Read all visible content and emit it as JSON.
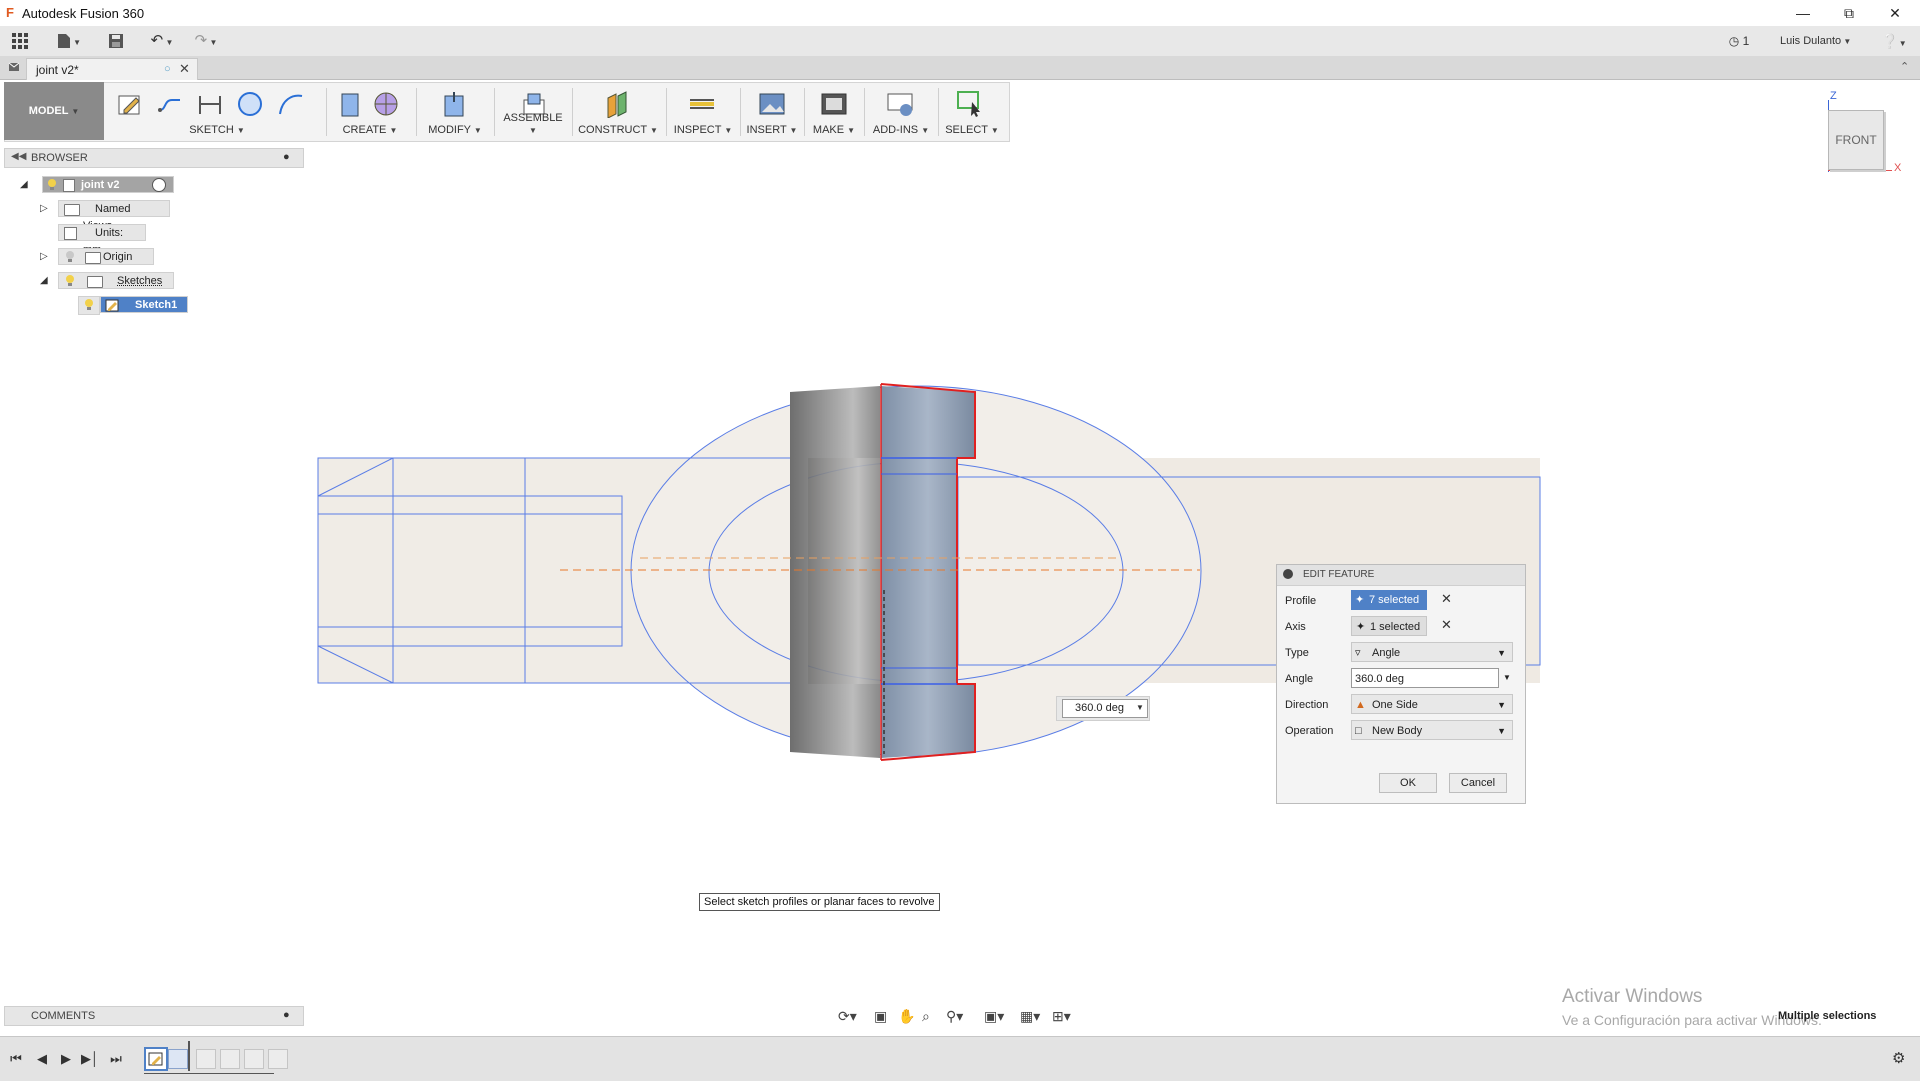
{
  "window": {
    "title": "Autodesk Fusion 360"
  },
  "qat": {
    "job_count": "1",
    "user": "Luis Dulanto"
  },
  "doc_tab": {
    "label": "joint v2*"
  },
  "toolbar": {
    "workspace": "MODEL",
    "groups": [
      "SKETCH",
      "CREATE",
      "MODIFY",
      "ASSEMBLE",
      "CONSTRUCT",
      "INSPECT",
      "INSERT",
      "MAKE",
      "ADD-INS",
      "SELECT"
    ]
  },
  "browser": {
    "title": "BROWSER",
    "root": "joint v2",
    "items": [
      "Named Views",
      "Units: mm",
      "Origin",
      "Sketches"
    ],
    "sketch": "Sketch1"
  },
  "viewcube": {
    "face": "FRONT",
    "axis_z": "Z",
    "axis_x": "X"
  },
  "edit_feature": {
    "title": "EDIT FEATURE",
    "rows": {
      "profile": {
        "label": "Profile",
        "value": "7 selected"
      },
      "axis": {
        "label": "Axis",
        "value": "1 selected"
      },
      "type": {
        "label": "Type",
        "value": "Angle"
      },
      "angle": {
        "label": "Angle",
        "value": "360.0 deg"
      },
      "direction": {
        "label": "Direction",
        "value": "One Side"
      },
      "operation": {
        "label": "Operation",
        "value": "New Body"
      }
    },
    "ok": "OK",
    "cancel": "Cancel"
  },
  "viewport": {
    "angle_input": "360.0 deg",
    "hint": "Select sketch profiles or planar faces to revolve"
  },
  "comments": {
    "title": "COMMENTS"
  },
  "status": {
    "watermark_title": "Activar Windows",
    "watermark_sub": "Ve a Configuración para activar Windows.",
    "selection": "Multiple selections"
  },
  "colors": {
    "accent": "#4f81c7",
    "profile_red": "#e02020",
    "sketch_blue": "#3a5ee8",
    "axis_orange": "#e8782a"
  }
}
